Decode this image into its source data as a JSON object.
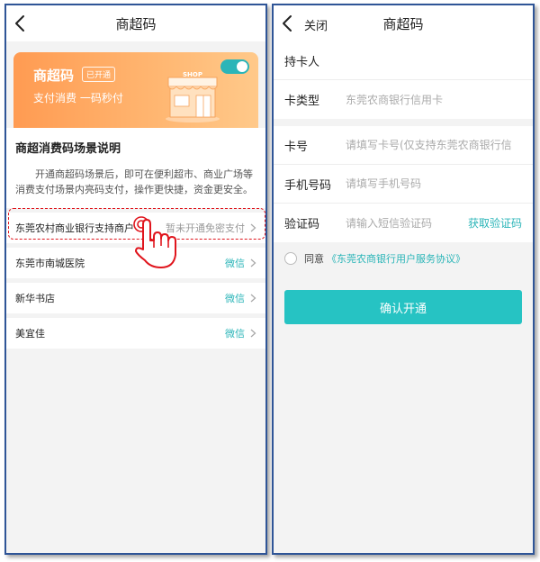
{
  "left": {
    "header": {
      "title": "商超码"
    },
    "card": {
      "title": "商超码",
      "badge": "已开通",
      "subtitle": "支付消费 一码秒付",
      "illustration_text": "SHOP",
      "toggle_on": true
    },
    "description": {
      "title": "商超消费码场景说明",
      "text": "开通商超码场景后，即可在便利超市、商业广场等消费支付场景内亮码支付，操作更快捷，资金更安全。"
    },
    "merchants": [
      {
        "name": "东莞农村商业银行支持商户",
        "status": "暂未开通免密支付",
        "status_muted": true
      },
      {
        "name": "东莞市南城医院",
        "status": "微信",
        "status_muted": false
      },
      {
        "name": "新华书店",
        "status": "微信",
        "status_muted": false
      },
      {
        "name": "美宜佳",
        "status": "微信",
        "status_muted": false
      }
    ]
  },
  "right": {
    "header": {
      "close_label": "关闭",
      "title": "商超码"
    },
    "form": {
      "holder_label": "持卡人",
      "holder_value": "",
      "card_type_label": "卡类型",
      "card_type_value": "东莞农商银行信用卡",
      "card_no_label": "卡号",
      "card_no_placeholder": "请填写卡号(仅支持东莞农商银行信",
      "phone_label": "手机号码",
      "phone_placeholder": "请填写手机号码",
      "code_label": "验证码",
      "code_placeholder": "请输入短信验证码",
      "get_code": "获取验证码"
    },
    "agreement": {
      "prefix": "同意",
      "link": "《东莞农商银行用户服务协议》"
    },
    "confirm_button": "确认开通"
  },
  "colors": {
    "accent": "#2bb5b8",
    "button": "#26c3c3",
    "hero_orange": "#ff9b52",
    "highlight": "#e0151d",
    "frame": "#2f5597"
  }
}
